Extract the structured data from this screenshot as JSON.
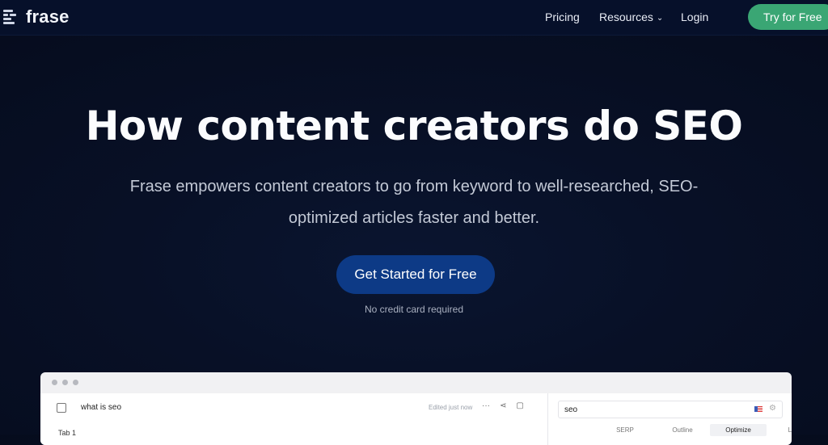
{
  "nav": {
    "brand": "frase",
    "links": [
      {
        "label": "Pricing"
      },
      {
        "label": "Resources"
      },
      {
        "label": "Login"
      }
    ],
    "try_label": "Try for Free"
  },
  "hero": {
    "title": "How content creators do SEO",
    "subtitle_line1": "Frase empowers content creators to go from keyword to well-researched, SEO-",
    "subtitle_line2": "optimized articles faster and better.",
    "cta_label": "Get Started for Free",
    "note": "No credit card required"
  },
  "app_preview": {
    "doc_title": "what is seo",
    "status": "Edited just now",
    "tab_label": "Tab 1",
    "search_query": "seo",
    "tabs": [
      "SERP",
      "Outline",
      "Optimize",
      "Links"
    ],
    "active_tab": "Optimize"
  },
  "colors": {
    "background": "#050b1c",
    "accent_green": "#3aa674",
    "cta_blue": "#0d3a86"
  }
}
